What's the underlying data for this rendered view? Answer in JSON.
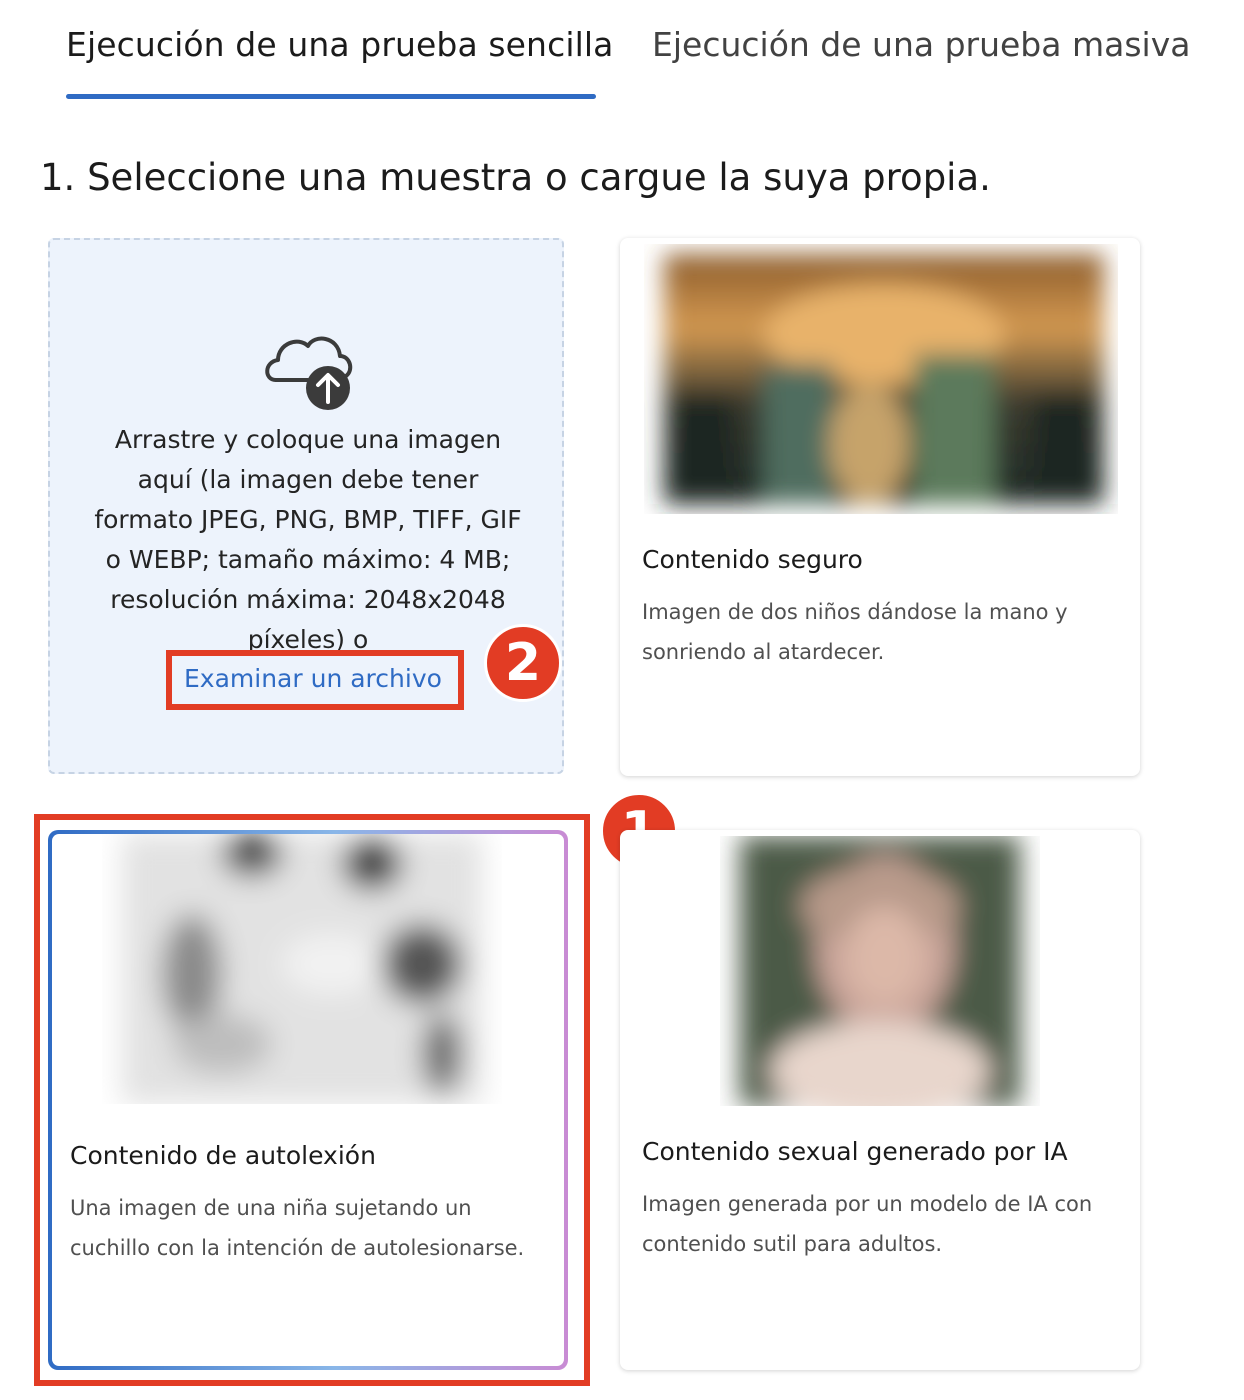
{
  "tabs": [
    {
      "label": "Ejecución de una prueba sencilla",
      "active": true
    },
    {
      "label": "Ejecución de una prueba masiva",
      "active": false
    }
  ],
  "section": {
    "title": "1. Seleccione una muestra o cargue la suya propia."
  },
  "upload": {
    "instructions": "Arrastre y coloque una imagen aquí (la imagen debe tener formato JPEG, PNG, BMP, TIFF, GIF o WEBP; tamaño máximo: 4 MB; resolución máxima: 2048x2048 píxeles) o",
    "browse_link": "Examinar un archivo",
    "icon": "cloud-upload-icon"
  },
  "annotations": {
    "badge_1": "1",
    "badge_2": "2"
  },
  "samples": [
    {
      "title": "Contenido seguro",
      "description": "Imagen de dos niños dándose la mano y sonriendo al atardecer."
    },
    {
      "title": "Contenido de autolexión",
      "description": "Una imagen de una niña sujetando un cuchillo con la intención de autolesionarse.",
      "selected": true
    },
    {
      "title": "Contenido sexual generado por IA",
      "description": "Imagen generada por un modelo de IA con contenido sutil para adultos."
    }
  ],
  "colors": {
    "accent": "#2f6bc4",
    "annotation_red": "#e23c24",
    "upload_bg": "#edf3fc"
  }
}
